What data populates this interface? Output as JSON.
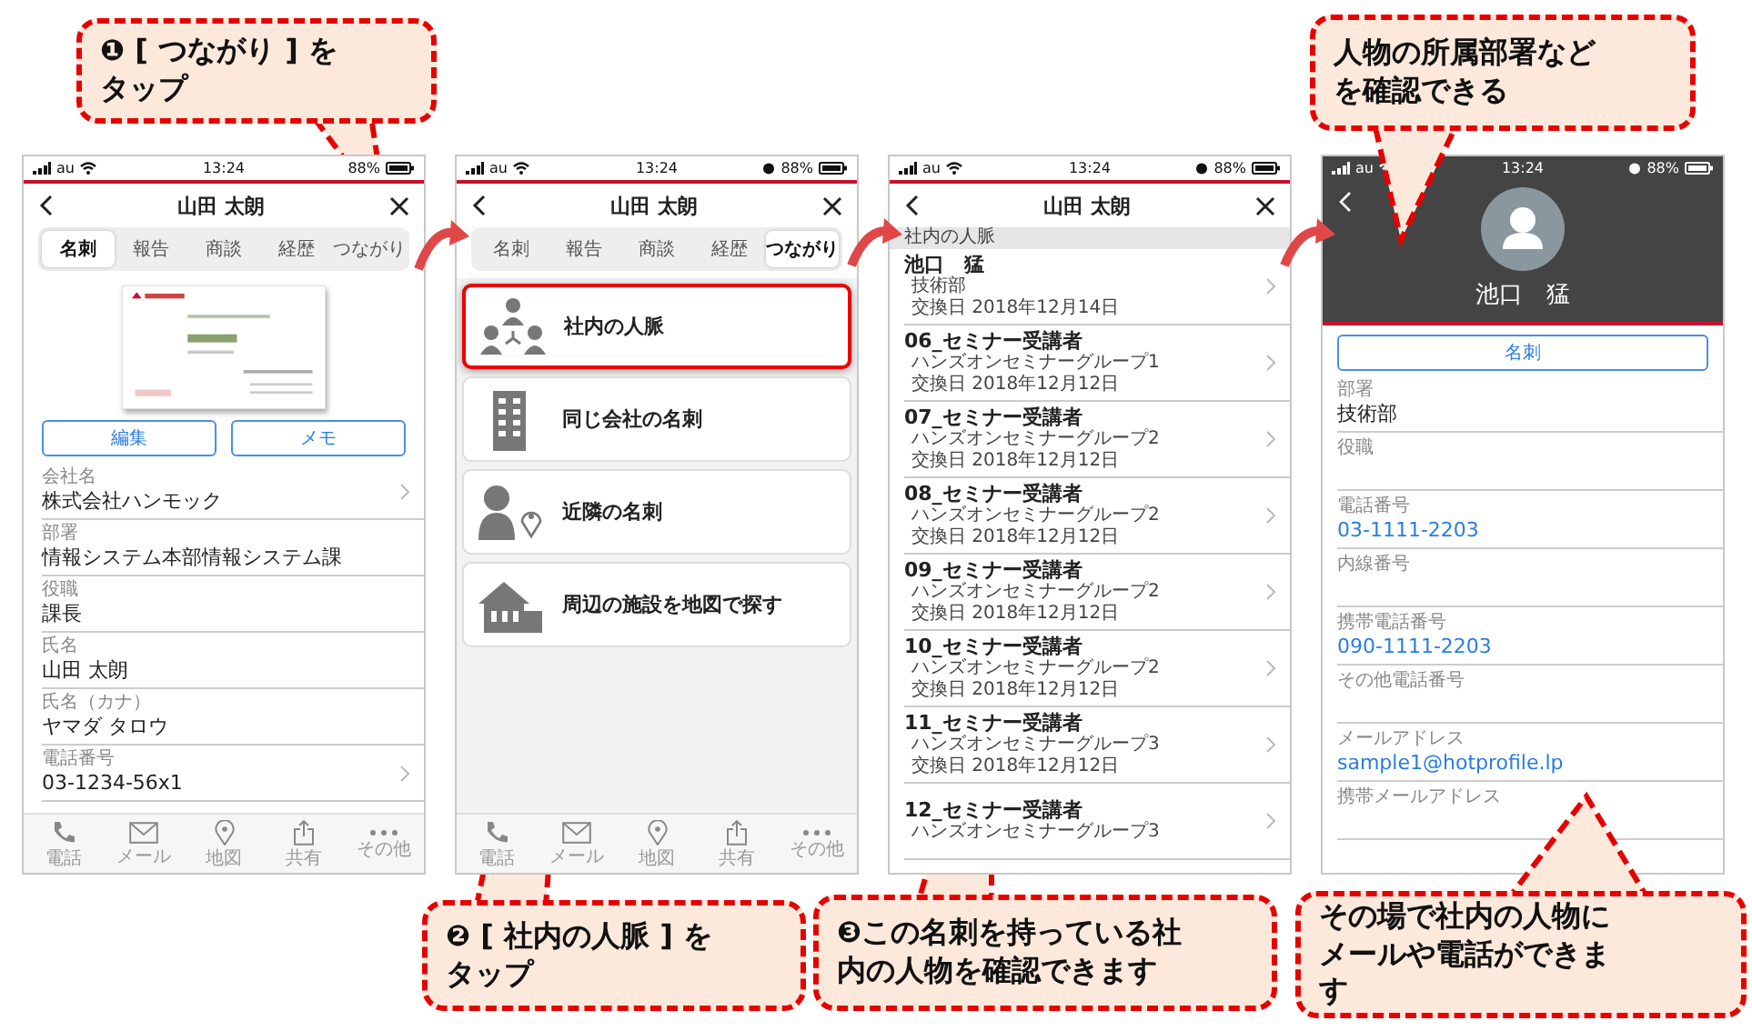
{
  "phones": [
    {
      "kind": "card",
      "status": {
        "carrier": "au",
        "time": "13:24",
        "battery": "88%"
      },
      "title": "山田 太朗",
      "tabs": [
        {
          "label": "名刺",
          "selected": true
        },
        {
          "label": "報告",
          "selected": false
        },
        {
          "label": "商談",
          "selected": false
        },
        {
          "label": "経歴",
          "selected": false
        },
        {
          "label": "つながり",
          "selected": false
        }
      ],
      "card_image": {
        "kind": "picture"
      },
      "buttons": [
        "編集",
        "メモ"
      ],
      "fields": [
        {
          "label": "会社名",
          "value": "株式会社ハンモック",
          "chevron": true
        },
        {
          "label": "部署",
          "value": "情報システム本部情報システム課",
          "chevron": false
        },
        {
          "label": "役職",
          "value": "課長",
          "chevron": false
        },
        {
          "label": "氏名",
          "value": "山田 太朗",
          "chevron": false
        },
        {
          "label": "氏名（カナ）",
          "value": "ヤマダ タロウ",
          "chevron": false
        },
        {
          "label": "電話番号",
          "value": "03-1234-56x1",
          "chevron": true
        }
      ],
      "bottom_bar": [
        {
          "kind": "phone",
          "label": "電話"
        },
        {
          "kind": "mail",
          "label": "メール"
        },
        {
          "kind": "pin",
          "label": "地図"
        },
        {
          "kind": "share",
          "label": "共有"
        },
        {
          "kind": "more",
          "label": "その他"
        }
      ]
    },
    {
      "kind": "connections",
      "status": {
        "carrier": "au",
        "time": "13:24",
        "battery": "88%",
        "alarm": true
      },
      "title": "山田 太朗",
      "tabs": [
        {
          "label": "名刺",
          "selected": false
        },
        {
          "label": "報告",
          "selected": false
        },
        {
          "label": "商談",
          "selected": false
        },
        {
          "label": "経歴",
          "selected": false
        },
        {
          "label": "つながり",
          "selected": true
        }
      ],
      "menu": [
        {
          "kind": "people",
          "label": "社内の人脈",
          "highlighted": true
        },
        {
          "kind": "building",
          "label": "同じ会社の名刺",
          "highlighted": false
        },
        {
          "kind": "person_pin",
          "label": "近隣の名刺",
          "highlighted": false
        },
        {
          "kind": "house",
          "label": "周辺の施設を地図で探す",
          "highlighted": false
        }
      ],
      "bottom_bar": [
        {
          "kind": "phone",
          "label": "電話"
        },
        {
          "kind": "mail",
          "label": "メール"
        },
        {
          "kind": "pin",
          "label": "地図"
        },
        {
          "kind": "share",
          "label": "共有"
        },
        {
          "kind": "more",
          "label": "その他"
        }
      ]
    },
    {
      "kind": "list",
      "status": {
        "carrier": "au",
        "time": "13:24",
        "battery": "88%",
        "alarm": true
      },
      "title": "山田 太朗",
      "section": "社内の人脈",
      "rows": [
        {
          "name": "池口　猛",
          "group": "技術部",
          "date": "交換日 2018年12月14日"
        },
        {
          "name": "06_セミナー受講者",
          "group": "ハンズオンセミナーグループ1",
          "date": "交換日 2018年12月12日"
        },
        {
          "name": "07_セミナー受講者",
          "group": "ハンズオンセミナーグループ2",
          "date": "交換日 2018年12月12日"
        },
        {
          "name": "08_セミナー受講者",
          "group": "ハンズオンセミナーグループ2",
          "date": "交換日 2018年12月12日"
        },
        {
          "name": "09_セミナー受講者",
          "group": "ハンズオンセミナーグループ2",
          "date": "交換日 2018年12月12日"
        },
        {
          "name": "10_セミナー受講者",
          "group": "ハンズオンセミナーグループ2",
          "date": "交換日 2018年12月12日"
        },
        {
          "name": "11_セミナー受講者",
          "group": "ハンズオンセミナーグループ3",
          "date": "交換日 2018年12月12日"
        },
        {
          "name": "12_セミナー受講者",
          "group": "ハンズオンセミナーグループ3"
        }
      ]
    },
    {
      "kind": "profile",
      "status": {
        "carrier": "au",
        "time": "13:24",
        "battery": "88%",
        "alarm": true
      },
      "name": "池口　猛",
      "button": "名刺",
      "fields": [
        {
          "label": "部署",
          "value": "技術部",
          "link": false
        },
        {
          "label": "役職"
        },
        {
          "label": "電話番号",
          "value": "03-1111-2203",
          "link": true
        },
        {
          "label": "内線番号"
        },
        {
          "label": "携帯電話番号",
          "value": "090-1111-2203",
          "link": true
        },
        {
          "label": "その他電話番号"
        },
        {
          "label": "メールアドレス",
          "value": "sample1@hotprofile.lp",
          "link": true
        },
        {
          "label": "携帯メールアドレス"
        }
      ]
    }
  ],
  "callouts": [
    {
      "text": "❶ [ つながり ] をタップ"
    },
    {
      "text": "人物の所属部署などを確認できる"
    },
    {
      "text": "❷ [ 社内の人脈 ] をタップ"
    },
    {
      "text": "❸この名刺を持っている社内の人物を確認できます"
    },
    {
      "text": "その場で社内の人物にメールや電話ができます"
    }
  ]
}
